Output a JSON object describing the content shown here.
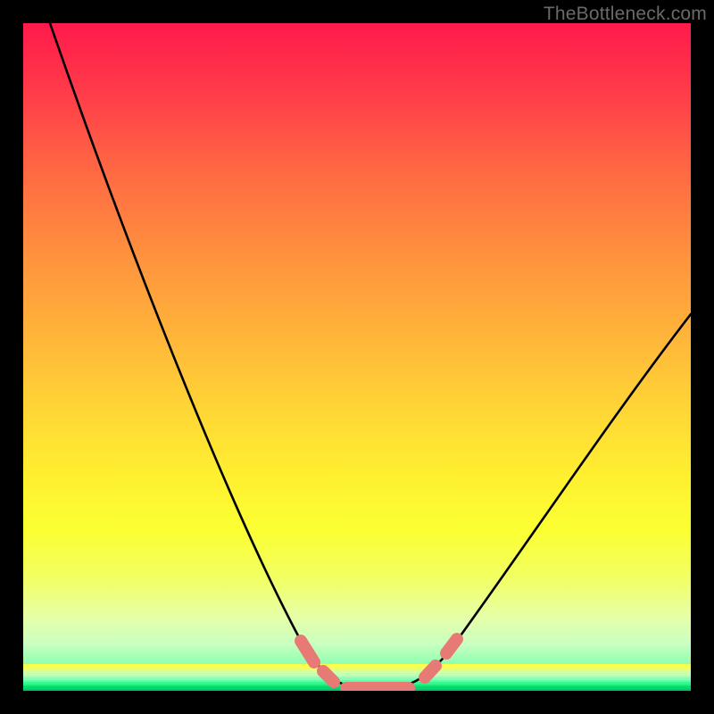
{
  "watermark": "TheBottleneck.com",
  "chart_data": {
    "type": "line",
    "title": "",
    "xlabel": "",
    "ylabel": "",
    "xlim": [
      0,
      100
    ],
    "ylim": [
      0,
      100
    ],
    "series": [
      {
        "name": "curve",
        "x": [
          4,
          10,
          20,
          30,
          38,
          44,
          48,
          50,
          54,
          58,
          62,
          70,
          80,
          90,
          100
        ],
        "y": [
          100,
          84,
          58,
          33,
          14,
          4,
          1,
          0,
          0,
          1,
          4,
          14,
          30,
          44,
          57
        ]
      }
    ],
    "markers": {
      "name": "highlight-segments",
      "color": "#e77a74",
      "segments": [
        {
          "x1": 42.5,
          "y1": 6.5,
          "x2": 44.5,
          "y2": 3.5
        },
        {
          "x1": 45.8,
          "y1": 2.3,
          "x2": 47.2,
          "y2": 1.0
        },
        {
          "x1": 48.5,
          "y1": 0.3,
          "x2": 58.0,
          "y2": 0.3
        },
        {
          "x1": 60.5,
          "y1": 1.8,
          "x2": 62.0,
          "y2": 3.2
        },
        {
          "x1": 63.5,
          "y1": 5.0,
          "x2": 65.0,
          "y2": 7.0
        }
      ]
    },
    "background_gradient": {
      "top": "#ff1a4b",
      "mid": "#ffe733",
      "bottom": "#00e070"
    }
  }
}
